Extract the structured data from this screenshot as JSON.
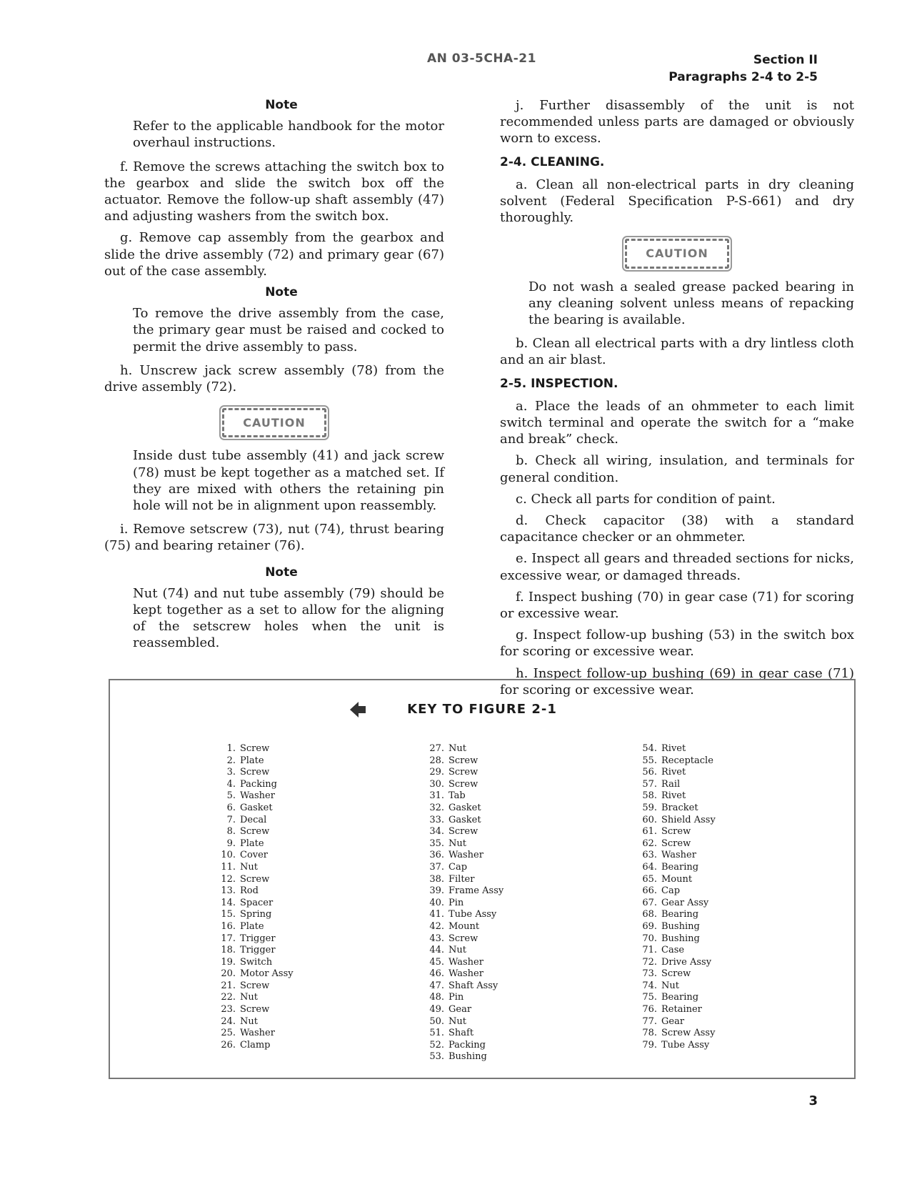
{
  "header": {
    "doc_number": "AN 03-5CHA-21",
    "section": "Section II",
    "paragraphs": "Paragraphs 2-4 to 2-5"
  },
  "left_column": {
    "note1": {
      "title": "Note",
      "body": "Refer to the applicable handbook for the motor overhaul instructions."
    },
    "para_f": "f. Remove the screws attaching the switch box to the gearbox and slide the switch box off the actuator. Remove the follow-up shaft assembly (47) and adjusting washers from the switch box.",
    "para_g": "g. Remove cap assembly from the gearbox and slide the drive assembly (72) and primary gear (67) out of the case assembly.",
    "note2": {
      "title": "Note",
      "body": "To remove the drive assembly from the case, the primary gear must be raised and cocked to permit the drive assembly to pass."
    },
    "para_h": "h. Unscrew jack screw assembly (78) from the drive assembly (72).",
    "caution1": {
      "label": "CAUTION",
      "body": "Inside dust tube assembly (41) and jack screw (78) must be kept together as a matched set. If they are mixed with others the retaining pin hole will not be in alignment upon reassembly."
    },
    "para_i": "i. Remove setscrew (73), nut (74), thrust bearing (75) and bearing retainer (76).",
    "note3": {
      "title": "Note",
      "body": "Nut (74) and nut tube assembly (79) should be kept together as a set to allow for the aligning of the setscrew holes when the unit is reassembled."
    }
  },
  "right_column": {
    "para_j": "j. Further disassembly of the unit is not recommended unless parts are damaged or obviously worn to excess.",
    "cleaning": {
      "heading": "2-4. CLEANING.",
      "para_a": "a. Clean all non-electrical parts in dry cleaning solvent (Federal Specification P-S-661) and dry thoroughly.",
      "caution": {
        "label": "CAUTION",
        "body": "Do not wash a sealed grease packed bearing in any cleaning solvent unless means of repacking the bearing is available."
      },
      "para_b": "b. Clean all electrical parts with a dry lintless cloth and an air blast."
    },
    "inspection": {
      "heading": "2-5. INSPECTION.",
      "items": [
        "a. Place the leads of an ohmmeter to each limit switch terminal and operate the switch for a “make and break” check.",
        "b. Check all wiring, insulation, and terminals for general condition.",
        "c. Check all parts for condition of paint.",
        "d. Check capacitor (38) with a standard capacitance checker or an ohmmeter.",
        "e. Inspect all gears and threaded sections for nicks, excessive wear, or damaged threads.",
        "f. Inspect bushing (70) in gear case (71) for scoring or excessive wear.",
        "g. Inspect follow-up bushing (53) in the switch box for scoring or excessive wear.",
        "h. Inspect follow-up bushing (69) in gear case (71) for scoring or excessive wear."
      ]
    }
  },
  "key": {
    "title": "KEY TO FIGURE 2-1",
    "icon": "arrow-left-icon",
    "columns": [
      [
        {
          "n": "1.",
          "name": "Screw"
        },
        {
          "n": "2.",
          "name": "Plate"
        },
        {
          "n": "3.",
          "name": "Screw"
        },
        {
          "n": "4.",
          "name": "Packing"
        },
        {
          "n": "5.",
          "name": "Washer"
        },
        {
          "n": "6.",
          "name": "Gasket"
        },
        {
          "n": "7.",
          "name": "Decal"
        },
        {
          "n": "8.",
          "name": "Screw"
        },
        {
          "n": "9.",
          "name": "Plate"
        },
        {
          "n": "10.",
          "name": "Cover"
        },
        {
          "n": "11.",
          "name": "Nut"
        },
        {
          "n": "12.",
          "name": "Screw"
        },
        {
          "n": "13.",
          "name": "Rod"
        },
        {
          "n": "14.",
          "name": "Spacer"
        },
        {
          "n": "15.",
          "name": "Spring"
        },
        {
          "n": "16.",
          "name": "Plate"
        },
        {
          "n": "17.",
          "name": "Trigger"
        },
        {
          "n": "18.",
          "name": "Trigger"
        },
        {
          "n": "19.",
          "name": "Switch"
        },
        {
          "n": "20.",
          "name": "Motor Assy"
        },
        {
          "n": "21.",
          "name": "Screw"
        },
        {
          "n": "22.",
          "name": "Nut"
        },
        {
          "n": "23.",
          "name": "Screw"
        },
        {
          "n": "24.",
          "name": "Nut"
        },
        {
          "n": "25.",
          "name": "Washer"
        },
        {
          "n": "26.",
          "name": "Clamp"
        }
      ],
      [
        {
          "n": "27.",
          "name": "Nut"
        },
        {
          "n": "28.",
          "name": "Screw"
        },
        {
          "n": "29.",
          "name": "Screw"
        },
        {
          "n": "30.",
          "name": "Screw"
        },
        {
          "n": "31.",
          "name": "Tab"
        },
        {
          "n": "32.",
          "name": "Gasket"
        },
        {
          "n": "33.",
          "name": "Gasket"
        },
        {
          "n": "34.",
          "name": "Screw"
        },
        {
          "n": "35.",
          "name": "Nut"
        },
        {
          "n": "36.",
          "name": "Washer"
        },
        {
          "n": "37.",
          "name": "Cap"
        },
        {
          "n": "38.",
          "name": "Filter"
        },
        {
          "n": "39.",
          "name": "Frame Assy"
        },
        {
          "n": "40.",
          "name": "Pin"
        },
        {
          "n": "41.",
          "name": "Tube Assy"
        },
        {
          "n": "42.",
          "name": "Mount"
        },
        {
          "n": "43.",
          "name": "Screw"
        },
        {
          "n": "44.",
          "name": "Nut"
        },
        {
          "n": "45.",
          "name": "Washer"
        },
        {
          "n": "46.",
          "name": "Washer"
        },
        {
          "n": "47.",
          "name": "Shaft Assy"
        },
        {
          "n": "48.",
          "name": "Pin"
        },
        {
          "n": "49.",
          "name": "Gear"
        },
        {
          "n": "50.",
          "name": "Nut"
        },
        {
          "n": "51.",
          "name": "Shaft"
        },
        {
          "n": "52.",
          "name": "Packing"
        },
        {
          "n": "53.",
          "name": "Bushing"
        }
      ],
      [
        {
          "n": "54.",
          "name": "Rivet"
        },
        {
          "n": "55.",
          "name": "Receptacle"
        },
        {
          "n": "56.",
          "name": "Rivet"
        },
        {
          "n": "57.",
          "name": "Rail"
        },
        {
          "n": "58.",
          "name": "Rivet"
        },
        {
          "n": "59.",
          "name": "Bracket"
        },
        {
          "n": "60.",
          "name": "Shield Assy"
        },
        {
          "n": "61.",
          "name": "Screw"
        },
        {
          "n": "62.",
          "name": "Screw"
        },
        {
          "n": "63.",
          "name": "Washer"
        },
        {
          "n": "64.",
          "name": "Bearing"
        },
        {
          "n": "65.",
          "name": "Mount"
        },
        {
          "n": "66.",
          "name": "Cap"
        },
        {
          "n": "67.",
          "name": "Gear Assy"
        },
        {
          "n": "68.",
          "name": "Bearing"
        },
        {
          "n": "69.",
          "name": "Bushing"
        },
        {
          "n": "70.",
          "name": "Bushing"
        },
        {
          "n": "71.",
          "name": "Case"
        },
        {
          "n": "72.",
          "name": "Drive Assy"
        },
        {
          "n": "73.",
          "name": "Screw"
        },
        {
          "n": "74.",
          "name": "Nut"
        },
        {
          "n": "75.",
          "name": "Bearing"
        },
        {
          "n": "76.",
          "name": "Retainer"
        },
        {
          "n": "77.",
          "name": "Gear"
        },
        {
          "n": "78.",
          "name": "Screw Assy"
        },
        {
          "n": "79.",
          "name": "Tube Assy"
        }
      ]
    ]
  },
  "page_number": "3"
}
